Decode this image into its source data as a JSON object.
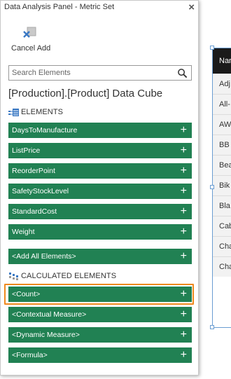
{
  "panel": {
    "title": "Data Analysis Panel - Metric Set",
    "close_symbol": "×",
    "cancel_add_label": "Cancel Add",
    "search_placeholder": "Search Elements",
    "cube_title": "[Production].[Product] Data Cube"
  },
  "elements": {
    "header": "ELEMENTS",
    "items": [
      "DaysToManufacture",
      "ListPrice",
      "ReorderPoint",
      "SafetyStockLevel",
      "StandardCost",
      "Weight"
    ],
    "add_all": "<Add All Elements>"
  },
  "calculated": {
    "header": "CALCULATED ELEMENTS",
    "items": [
      "<Count>",
      "<Contextual Measure>",
      "<Dynamic Measure>",
      "<Formula>"
    ],
    "highlighted_item": "<Count>"
  },
  "plus_symbol": "+",
  "colors": {
    "item_bg": "#218152",
    "highlight": "#ef8a1e",
    "selection_border": "#6a9ed3"
  },
  "background_table": {
    "header": "Nar",
    "rows": [
      "Adj",
      "All-",
      "AW",
      "BB",
      "Bea",
      "Bik",
      "Bla",
      "Cab",
      "Cha",
      "Cha"
    ]
  }
}
